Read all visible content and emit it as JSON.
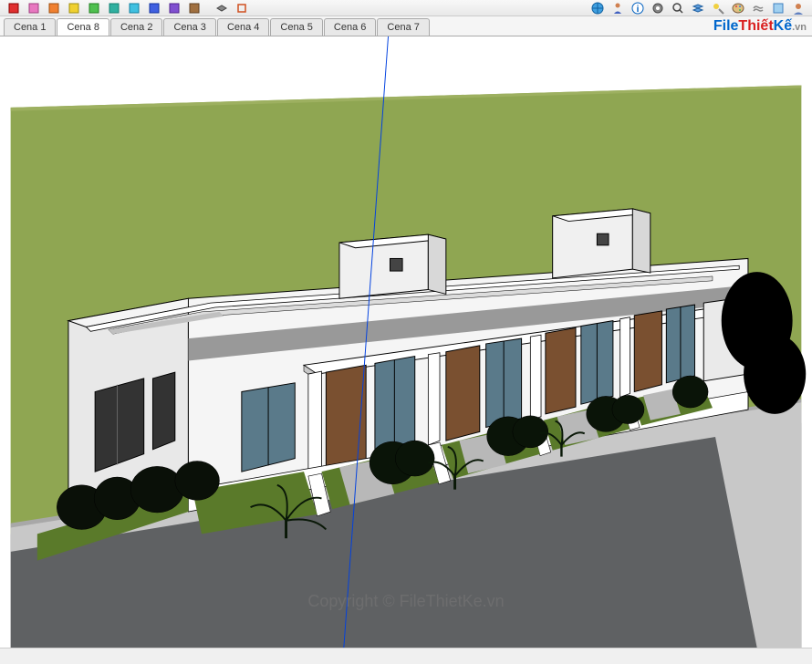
{
  "scenes": {
    "tabs": [
      {
        "label": "Cena 1",
        "active": false
      },
      {
        "label": "Cena 8",
        "active": true
      },
      {
        "label": "Cena 2",
        "active": false
      },
      {
        "label": "Cena 3",
        "active": false
      },
      {
        "label": "Cena 4",
        "active": false
      },
      {
        "label": "Cena 5",
        "active": false
      },
      {
        "label": "Cena 6",
        "active": false
      },
      {
        "label": "Cena 7",
        "active": false
      }
    ]
  },
  "watermark": {
    "file": "File",
    "thiet": "Thiết",
    "ke": "Kế",
    "vn": ".vn"
  },
  "copyright": {
    "text": "Copyright © FileThietKe.vn"
  },
  "toolbar": {
    "icons": [
      "paint-red",
      "paint-red",
      "paint-pink",
      "paint-pink",
      "paint-orange",
      "paint-orange",
      "paint-yellow",
      "paint-yellow",
      "paint-green",
      "paint-green",
      "paint-teal",
      "paint-teal",
      "paint-cyan",
      "paint-cyan",
      "paint-blue",
      "paint-blue",
      "paint-purple",
      "paint-purple",
      "paint-brown",
      "paint-brown",
      "layer-tool",
      "section-tool",
      "globe-icon",
      "person-icon",
      "element-info",
      "gear-icon",
      "search-icon",
      "layers-icon",
      "shadow-icon",
      "palette-icon",
      "fog-icon",
      "style-icon",
      "user-icon"
    ]
  },
  "model": {
    "description": "Single-storey row house 3D model, white walls, flat roof with parapet, two roof access blocks, brown doors, windows, front landscaping with bushes and small palms, gray street and sidewalk, green lawn behind."
  }
}
